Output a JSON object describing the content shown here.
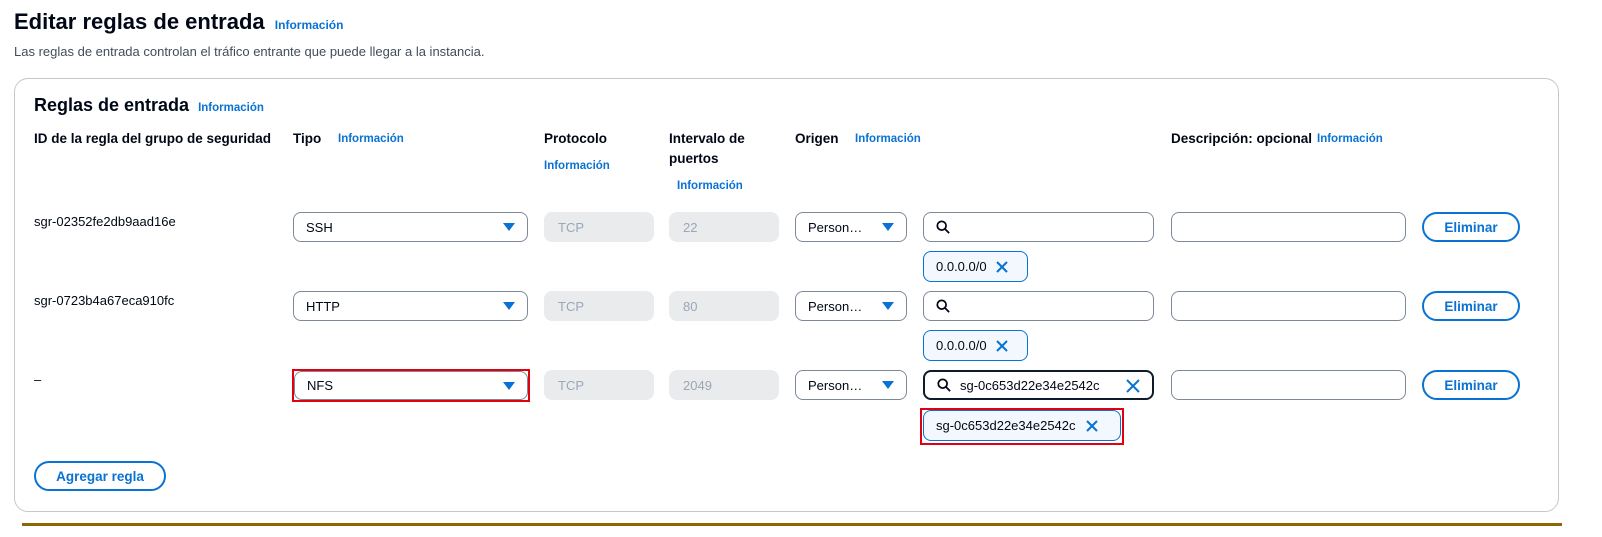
{
  "page": {
    "title": "Editar reglas de entrada",
    "title_info": "Información",
    "subtitle": "Las reglas de entrada controlan el tráfico entrante que puede llegar a la instancia."
  },
  "panel": {
    "title": "Reglas de entrada",
    "title_info": "Información",
    "columns": {
      "rule_id": "ID de la regla del grupo de seguridad",
      "type": "Tipo",
      "type_info": "Información",
      "protocol": "Protocolo",
      "protocol_info": "Información",
      "port_range_line1": "Intervalo de",
      "port_range_line2": "puertos",
      "port_range_info": "Información",
      "source": "Origen",
      "source_info": "Información",
      "description": "Descripción: opcional",
      "description_info": "Información"
    },
    "rows": [
      {
        "id": "sgr-02352fe2db9aad16e",
        "type": "SSH",
        "protocol": "TCP",
        "port": "22",
        "source": "Person…",
        "search_value": "",
        "token": "0.0.0.0/0",
        "delete": "Eliminar"
      },
      {
        "id": "sgr-0723b4a67eca910fc",
        "type": "HTTP",
        "protocol": "TCP",
        "port": "80",
        "source": "Person…",
        "search_value": "",
        "token": "0.0.0.0/0",
        "delete": "Eliminar"
      },
      {
        "id": "–",
        "type": "NFS",
        "protocol": "TCP",
        "port": "2049",
        "source": "Person…",
        "search_value": "sg-0c653d22e34e2542c",
        "token": "sg-0c653d22e34e2542c",
        "delete": "Eliminar"
      }
    ],
    "add_rule": "Agregar regla"
  },
  "icons": {
    "search": "search-icon",
    "close": "close-icon",
    "caret": "caret-down-icon"
  },
  "colors": {
    "link": "#0972d3",
    "highlight": "#e0000f",
    "disabled_bg": "#e9ebed"
  }
}
